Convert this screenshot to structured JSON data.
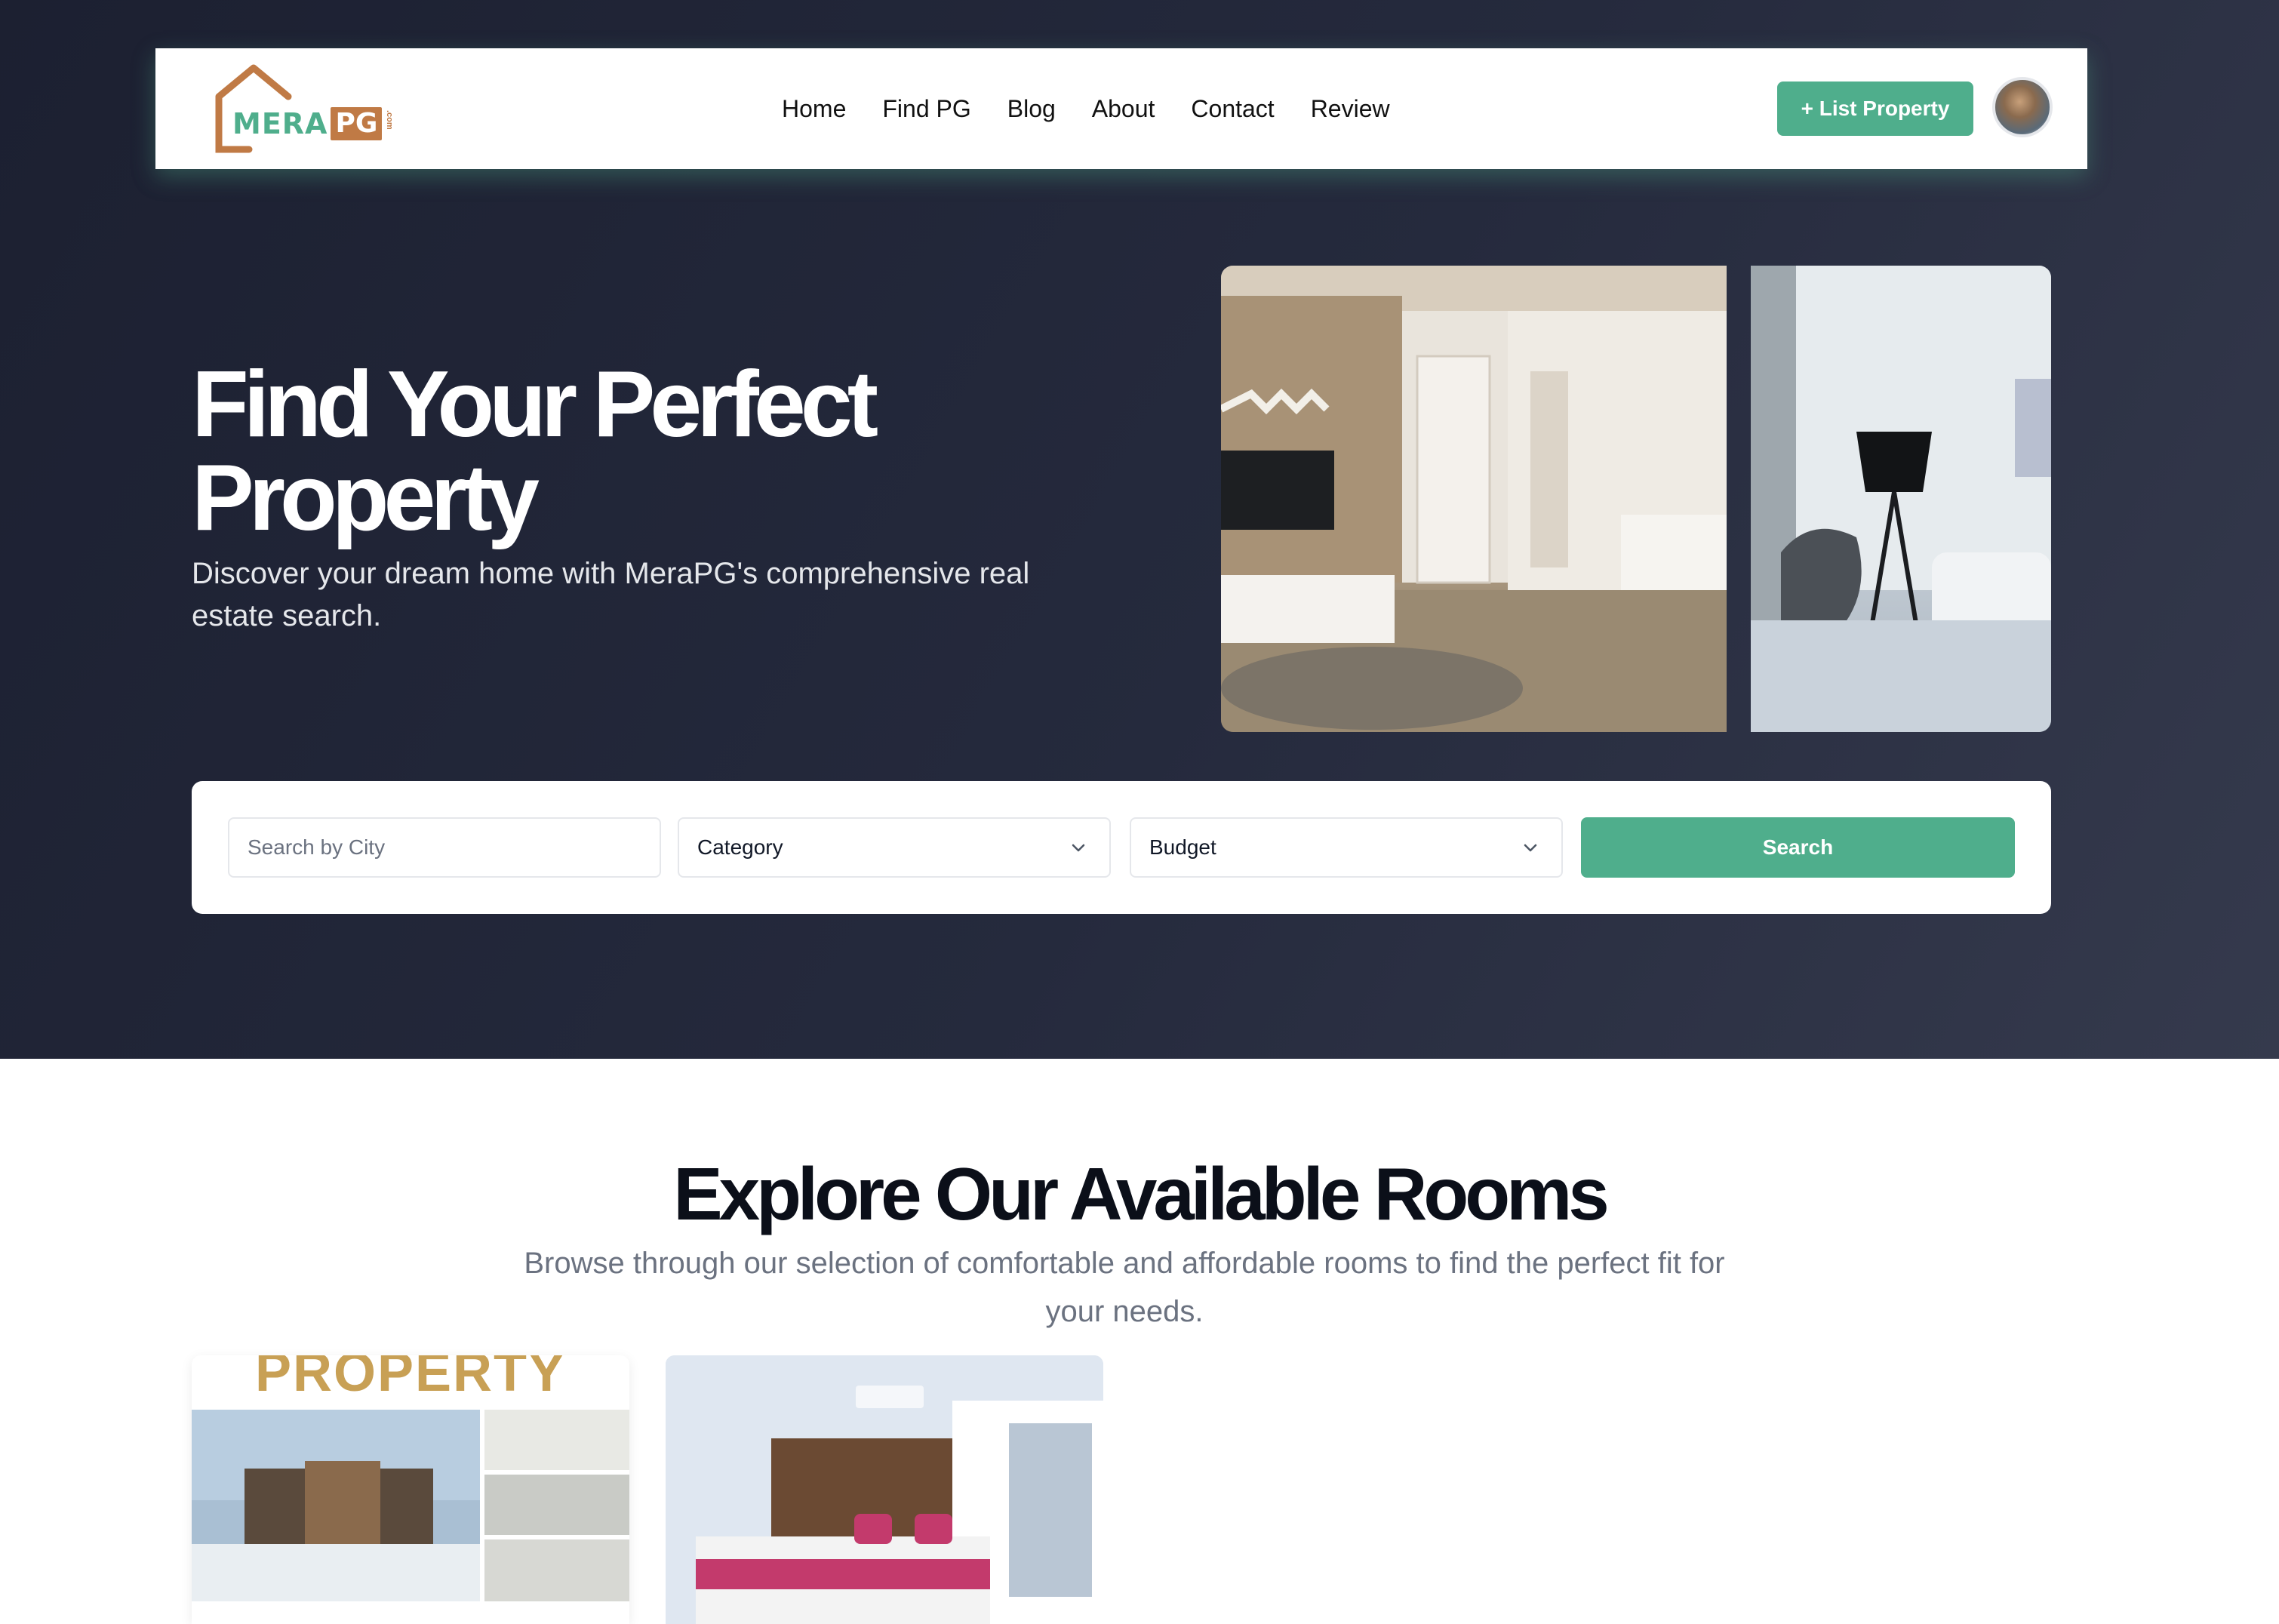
{
  "brand": {
    "logo_main": "MERA",
    "logo_accent": "PG",
    "logo_suffix": ".com"
  },
  "nav": {
    "links": [
      "Home",
      "Find PG",
      "Blog",
      "About",
      "Contact",
      "Review"
    ],
    "cta_label": "+ List Property"
  },
  "hero": {
    "title": "Find Your Perfect Property",
    "subtitle": "Discover your dream home with MeraPG's comprehensive real estate search."
  },
  "search": {
    "city_placeholder": "Search by City",
    "category_label": "Category",
    "budget_label": "Budget",
    "button_label": "Search"
  },
  "explore": {
    "title": "Explore Our Available Rooms",
    "subtitle": "Browse through our selection of comfortable and affordable rooms to find the perfect fit for your needs."
  },
  "cards": [
    {
      "banner_text": "PROPERTY"
    },
    {
      "banner_text": ""
    }
  ],
  "colors": {
    "accent": "#4fae8c",
    "logo_brown": "#c07a45",
    "hero_bg": "#1c2031"
  }
}
